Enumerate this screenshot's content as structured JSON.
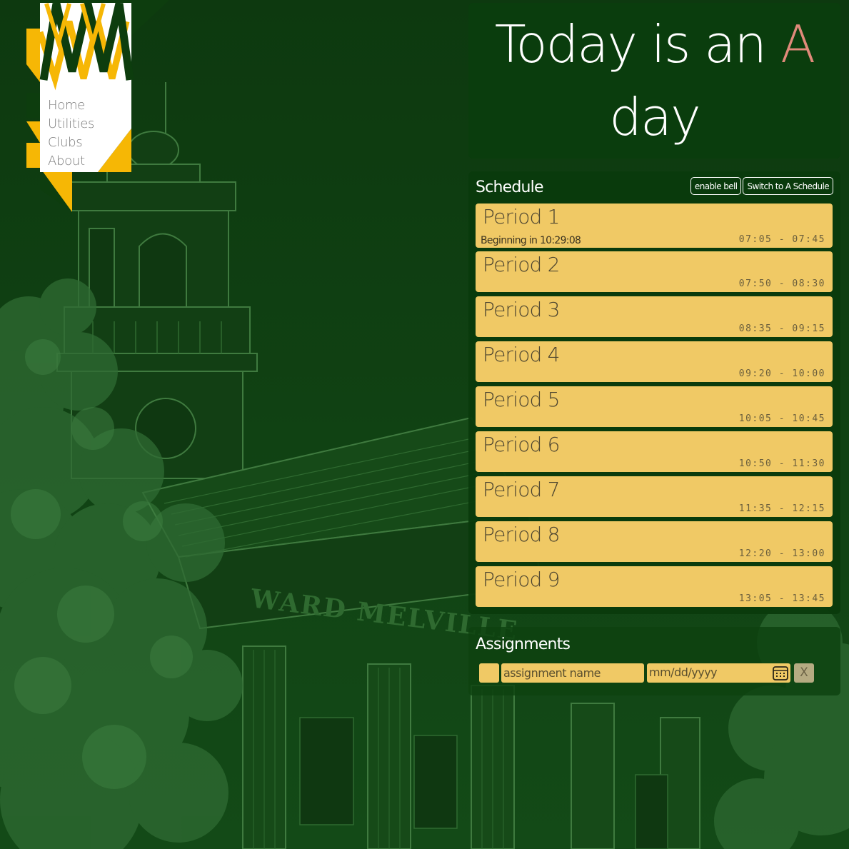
{
  "nav": {
    "items": [
      {
        "label": "Home"
      },
      {
        "label": "Utilities"
      },
      {
        "label": "Clubs"
      },
      {
        "label": "About"
      }
    ]
  },
  "day": {
    "prefix": "Today is an",
    "letter": "A",
    "suffix": "day"
  },
  "schedule": {
    "title": "Schedule",
    "bell_button": "enable bell",
    "switch_button": "Switch to A Schedule",
    "periods": [
      {
        "name": "Period 1",
        "status": "Beginning in 10:29:08",
        "time": "07:05 - 07:45"
      },
      {
        "name": "Period 2",
        "time": "07:50 - 08:30"
      },
      {
        "name": "Period 3",
        "time": "08:35 - 09:15"
      },
      {
        "name": "Period 4",
        "time": "09:20 - 10:00"
      },
      {
        "name": "Period 5",
        "time": "10:05 - 10:45"
      },
      {
        "name": "Period 6",
        "time": "10:50 - 11:30"
      },
      {
        "name": "Period 7",
        "time": "11:35 - 12:15"
      },
      {
        "name": "Period 8",
        "time": "12:20 - 13:00"
      },
      {
        "name": "Period 9",
        "time": "13:05 - 13:45"
      }
    ]
  },
  "assignments": {
    "title": "Assignments",
    "name_placeholder": "assignment name",
    "date_placeholder": "mm/dd/yyyy",
    "remove_label": "X"
  },
  "background": {
    "building_sign": "WARD MELVILLE"
  },
  "colors": {
    "page_bg": "#0e3a10",
    "panel_bg": "#0a3d0d",
    "period_bg": "#f0c965",
    "day_letter": "#e08a7a",
    "logo_green": "#0d3d0e",
    "logo_gold": "#f6b705"
  }
}
